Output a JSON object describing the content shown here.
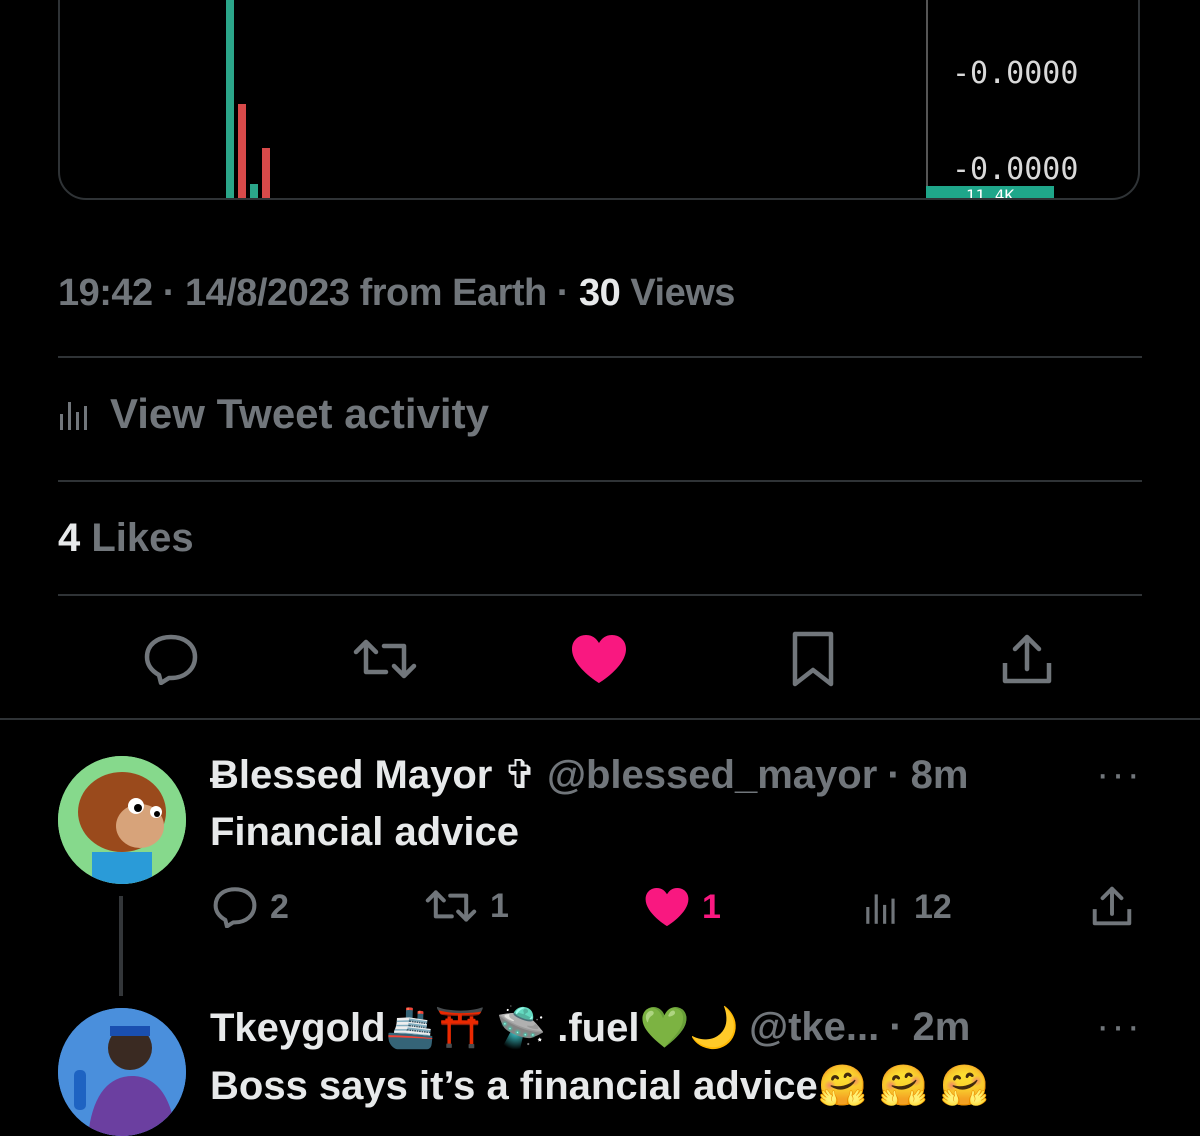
{
  "chart": {
    "price_labels": [
      "-0.0000",
      "-0.0000"
    ],
    "volume_badge": "11.4K"
  },
  "tweet_meta": {
    "time": "19:42",
    "date": "14/8/2023",
    "source": "from Earth",
    "views_count": "30",
    "views_label": "Views"
  },
  "activity": {
    "label": "View Tweet activity"
  },
  "likes": {
    "count": "4",
    "label": "Likes"
  },
  "colors": {
    "like": "#f91880",
    "muted": "#71767b",
    "text": "#e7e9ea"
  },
  "replies": [
    {
      "name": "Ƀlessed Mayor ✞",
      "handle": "@blessed_mayor",
      "time": "8m",
      "text": "Financial advice",
      "stats": {
        "replies": "2",
        "retweets": "1",
        "likes": "1",
        "views": "12"
      }
    },
    {
      "name": "Tkeygold🚢⛩️ 🛸 .fuel💚🌙",
      "handle": "@tke...",
      "time": "2m",
      "text": "Boss says it’s a financial advice🤗 🤗 🤗"
    }
  ],
  "more_icon": "···"
}
